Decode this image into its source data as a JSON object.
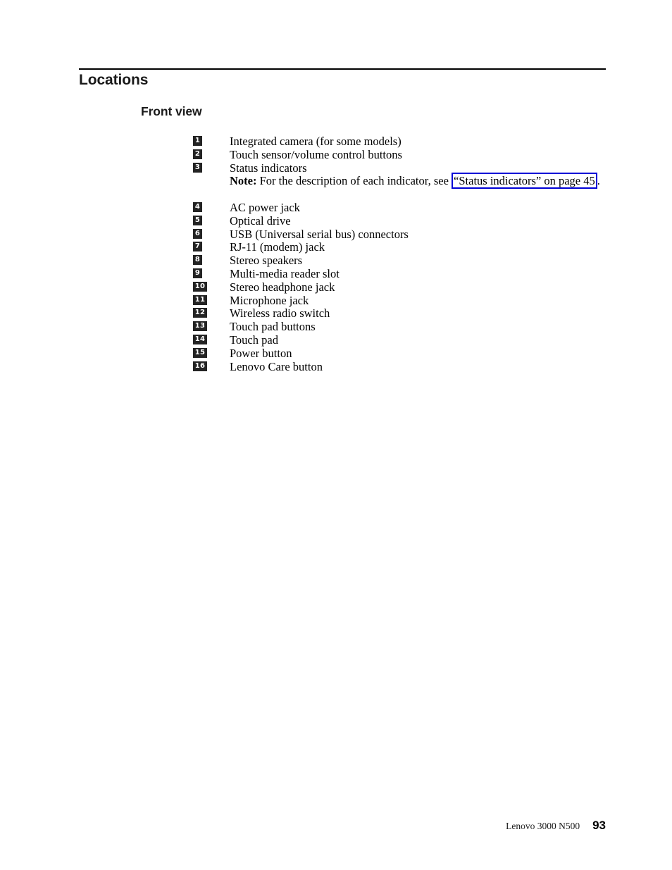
{
  "document": {
    "section_title": "Locations",
    "subsection_title": "Front view"
  },
  "parts_list": [
    {
      "number": "1",
      "label": "Integrated camera (for some models)"
    },
    {
      "number": "2",
      "label": "Touch sensor/volume control buttons"
    },
    {
      "number": "3",
      "label": "Status indicators"
    },
    {
      "number": "4",
      "label": "AC power jack"
    },
    {
      "number": "5",
      "label": "Optical drive"
    },
    {
      "number": "6",
      "label": "USB (Universal serial bus) connectors"
    },
    {
      "number": "7",
      "label": "RJ-11 (modem) jack"
    },
    {
      "number": "8",
      "label": "Stereo speakers"
    },
    {
      "number": "9",
      "label": "Multi-media reader slot"
    },
    {
      "number": "10",
      "label": "Stereo headphone jack"
    },
    {
      "number": "11",
      "label": "Microphone jack"
    },
    {
      "number": "12",
      "label": "Wireless radio switch"
    },
    {
      "number": "13",
      "label": "Touch pad buttons"
    },
    {
      "number": "14",
      "label": "Touch pad"
    },
    {
      "number": "15",
      "label": "Power button"
    },
    {
      "number": "16",
      "label": "Lenovo Care button"
    }
  ],
  "note": {
    "prefix": "Note:",
    "text_before_link": " For the description of each indicator, see ",
    "link_text": "“Status indicators” on page 45",
    "text_after_link": "."
  },
  "footer": {
    "product": "Lenovo 3000 N500",
    "page_number": "93"
  },
  "colors": {
    "link_border": "#0000d6",
    "badge_background": "#232323",
    "badge_text": "#ffffff",
    "body_text": "#000000"
  }
}
